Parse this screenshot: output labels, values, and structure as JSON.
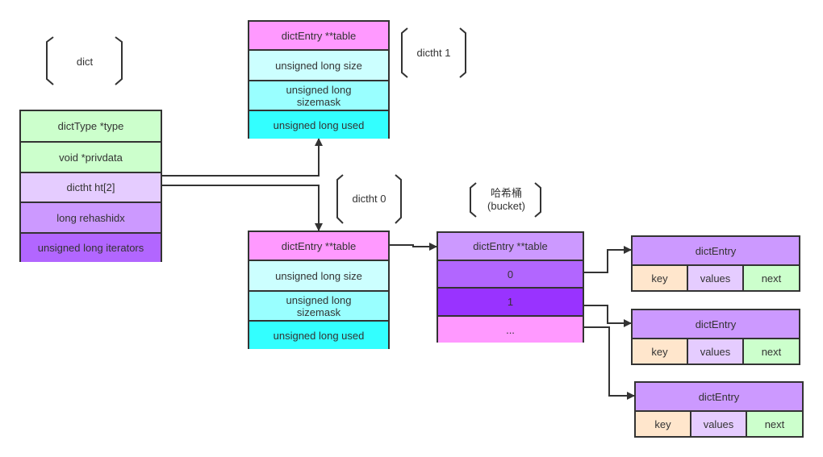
{
  "colors": {
    "green": "#ccffcc",
    "lavender": "#e5ccff",
    "purple_light": "#cc99ff",
    "purple_mid": "#b266ff",
    "purple_dark": "#9933ff",
    "pink": "#ff99ff",
    "cyan_light": "#ccffff",
    "cyan_mid": "#99ffff",
    "cyan": "#33ffff",
    "peach": "#ffe6cc"
  },
  "dict": {
    "bracket_label": "dict",
    "fields": [
      "dictType *type",
      "void *privdata",
      "dictht ht[2]",
      "long rehashidx",
      "unsigned long iterators"
    ]
  },
  "dictht1": {
    "bracket_label": "dictht 1",
    "fields": [
      "dictEntry **table",
      "unsigned long size",
      "unsigned long sizemask",
      "unsigned long used"
    ]
  },
  "dictht0": {
    "bracket_label": "dictht 0",
    "fields": [
      "dictEntry **table",
      "unsigned long size",
      "unsigned long sizemask",
      "unsigned long used"
    ]
  },
  "bucket": {
    "bracket_label_line1": "哈希桶",
    "bracket_label_line2": "(bucket)",
    "fields": [
      "dictEntry **table",
      "0",
      "1",
      "..."
    ]
  },
  "entries": [
    {
      "title": "dictEntry",
      "key": "key",
      "values": "values",
      "next": "next"
    },
    {
      "title": "dictEntry",
      "key": "key",
      "values": "values",
      "next": "next"
    },
    {
      "title": "dictEntry",
      "key": "key",
      "values": "values",
      "next": "next"
    }
  ]
}
